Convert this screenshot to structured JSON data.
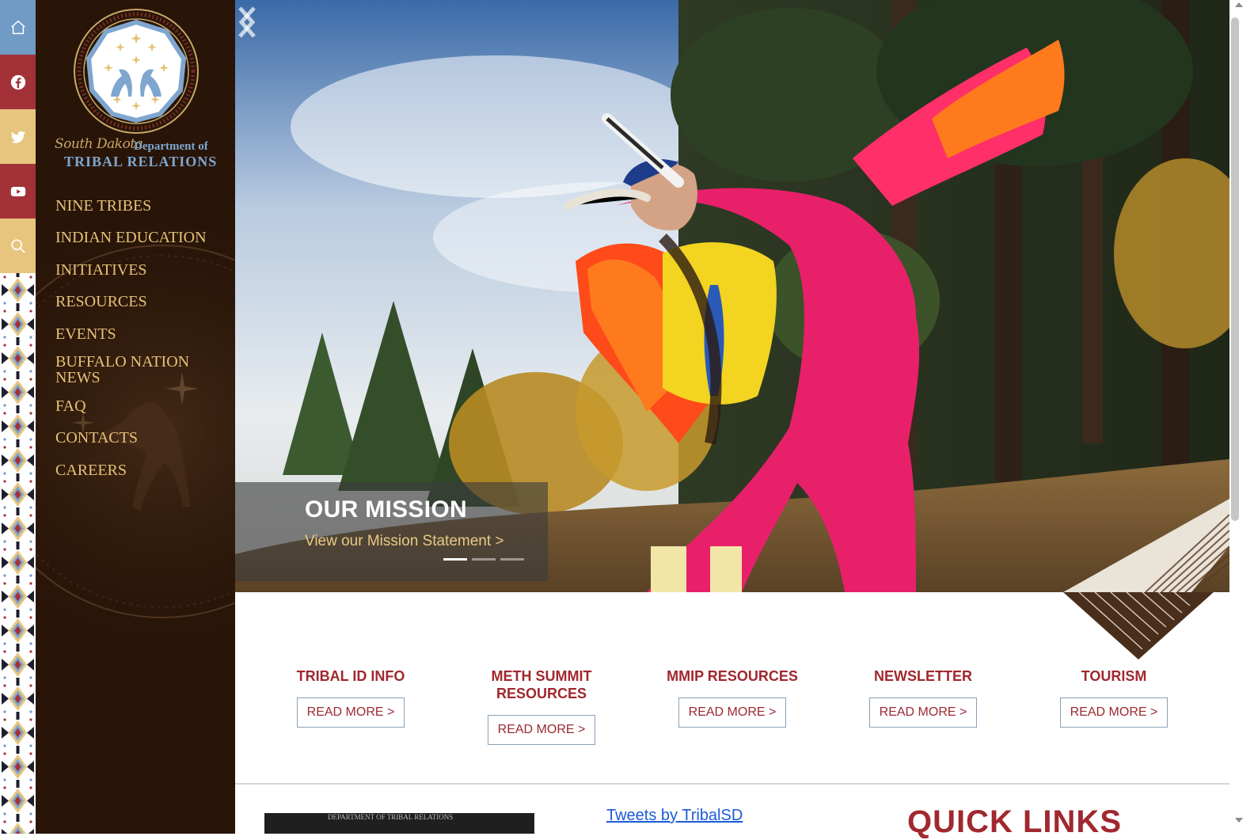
{
  "social": {
    "items": [
      {
        "id": "home",
        "icon": "home-icon"
      },
      {
        "id": "facebook",
        "icon": "facebook-icon"
      },
      {
        "id": "twitter",
        "icon": "twitter-icon"
      },
      {
        "id": "youtube",
        "icon": "youtube-icon"
      },
      {
        "id": "search",
        "icon": "search-icon"
      }
    ]
  },
  "brand": {
    "script": "South Dakota",
    "department": "Department of",
    "name": "TRIBAL RELATIONS"
  },
  "nav": {
    "items": [
      {
        "label": "NINE TRIBES"
      },
      {
        "label": "INDIAN EDUCATION"
      },
      {
        "label": "INITIATIVES"
      },
      {
        "label": "RESOURCES"
      },
      {
        "label": "EVENTS"
      },
      {
        "label": "BUFFALO NATION"
      },
      {
        "label": "NEWS"
      },
      {
        "label": "FAQ"
      },
      {
        "label": "CONTACTS"
      },
      {
        "label": "CAREERS"
      }
    ]
  },
  "hero": {
    "title": "OUR MISSION",
    "link": "View our Mission Statement >",
    "slide_count": 3,
    "active_slide": 1
  },
  "features": [
    {
      "title_lines": [
        "TRIBAL ID INFO"
      ],
      "button": "READ MORE >"
    },
    {
      "title_lines": [
        "METH SUMMIT",
        "RESOURCES"
      ],
      "button": "READ MORE >"
    },
    {
      "title_lines": [
        "MMIP RESOURCES"
      ],
      "button": "READ MORE >"
    },
    {
      "title_lines": [
        "NEWSLETTER"
      ],
      "button": "READ MORE >"
    },
    {
      "title_lines": [
        "TOURISM"
      ],
      "button": "READ MORE >"
    }
  ],
  "bottom": {
    "video_label": "DEPARTMENT OF TRIBAL RELATIONS",
    "tweets_link": "Tweets by TribalSD",
    "quick_links": "QUICK LINKS"
  },
  "colors": {
    "nav_bg": "#281508",
    "nav_text": "#e6c278",
    "accent_red": "#a0282e",
    "accent_blue": "#6f9bc4",
    "accent_gold": "#e7c57e"
  }
}
